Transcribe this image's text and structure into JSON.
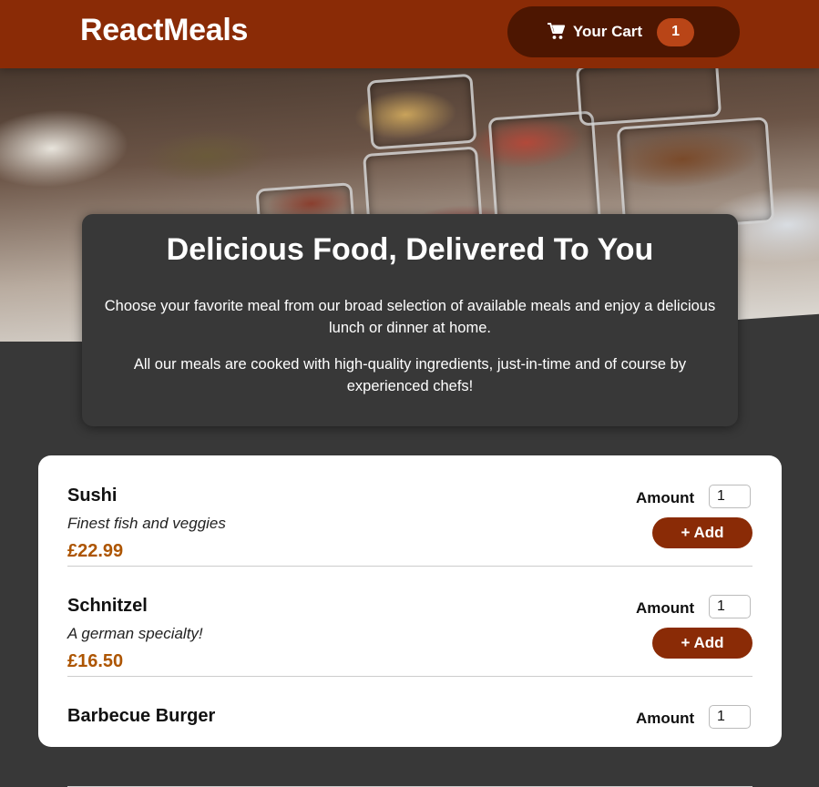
{
  "header": {
    "logo": "ReactMeals",
    "cart_label": "Your Cart",
    "cart_count": "1",
    "cart_icon": "shopping-cart-icon"
  },
  "summary": {
    "title": "Delicious Food, Delivered To You",
    "paragraph1": "Choose your favorite meal from our broad selection of available meals and enjoy a delicious lunch or dinner at home.",
    "paragraph2": "All our meals are cooked with high-quality ingredients, just-in-time and of course by experienced chefs!"
  },
  "meals": [
    {
      "name": "Sushi",
      "description": "Finest fish and veggies",
      "price": "£22.99",
      "amount_label": "Amount",
      "amount_value": "1",
      "add_label": "+ Add"
    },
    {
      "name": "Schnitzel",
      "description": "A german specialty!",
      "price": "£16.50",
      "amount_label": "Amount",
      "amount_value": "1",
      "add_label": "+ Add"
    },
    {
      "name": "Barbecue Burger",
      "description": "",
      "price": "",
      "amount_label": "Amount",
      "amount_value": "1",
      "add_label": ""
    }
  ],
  "colors": {
    "header_bg": "#8a2b06",
    "cart_button_bg": "#4d1601",
    "badge_bg": "#b94517",
    "price": "#ad5502",
    "page_bg": "#383838"
  }
}
